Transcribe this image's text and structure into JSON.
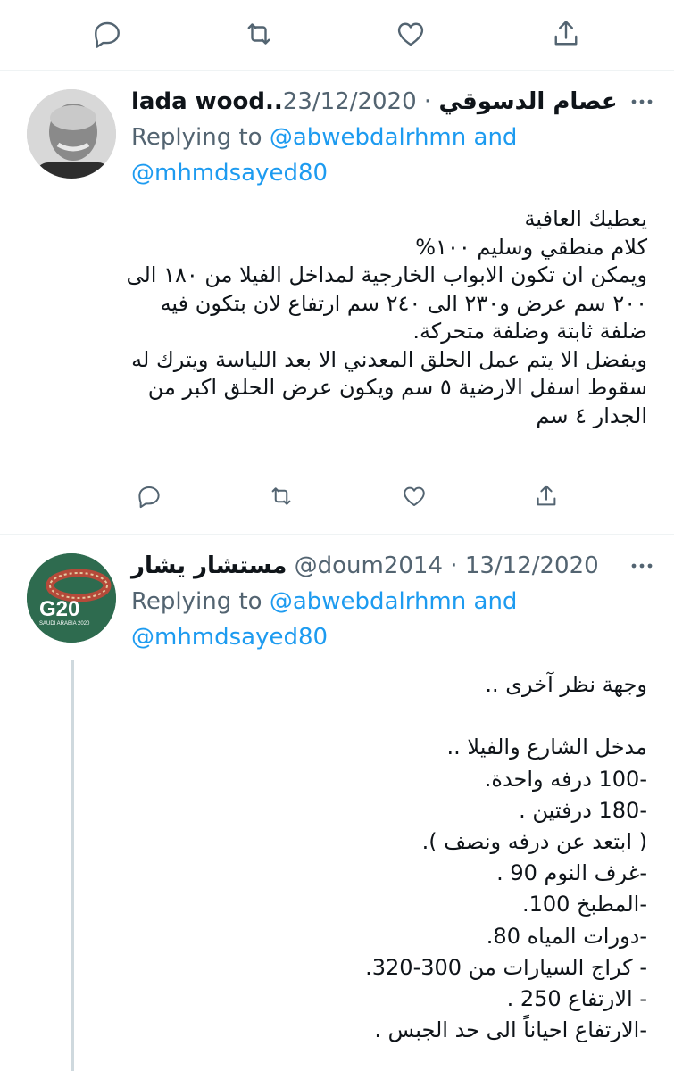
{
  "top_actions": [
    "reply-icon",
    "retweet-icon",
    "like-icon",
    "share-icon"
  ],
  "tweet1": {
    "name": "lada wood..عصام الدسوقي",
    "separator": " · ",
    "date": "23/12/2020",
    "replying_prefix": "Replying to ",
    "replying_user1": "@abwebdalrhmn",
    "replying_and": " and",
    "replying_user2": "@mhmdsayed80",
    "text": "يعطيك العافية\nكلام منطقي وسليم ١٠٠%\nويمكن ان تكون الابواب الخارجية لمداخل الفيلا من ١٨٠ الى ٢٠٠ سم عرض و٢٣٠ الى ٢٤٠ سم ارتفاع لان بتكون فيه ضلفة ثابتة وضلفة متحركة.\nويفضل الا يتم عمل الحلق المعدني الا بعد اللياسة ويترك له سقوط اسفل الارضية ٥ سم ويكون عرض الحلق اكبر من الجدار ٤ سم"
  },
  "tweet2": {
    "name": "مستشار يشار",
    "handle": "@doum2014",
    "separator": " · ",
    "date": "13/12/2020",
    "replying_prefix": "Replying to ",
    "replying_user1": "@abwebdalrhmn",
    "replying_and": " and",
    "replying_user2": "@mhmdsayed80",
    "avatar_text": "G20",
    "avatar_subtext": "SAUDI ARABIA 2020",
    "text": "وجهة نظر آخرى ..\n\nمدخل الشارع والفيلا ..\n-100 درفه واحدة.\n-180 درفتين .\n( ابتعد عن درفه ونصف ).\n-غرف النوم 90 .\n-المطبخ 100.\n-دورات المياه 80.\n- كراج السيارات من 300-320.\n- الارتفاع 250 .\n-الارتفاع احياناً الى حد الجبس ."
  },
  "colors": {
    "accent": "#1d9bf0",
    "secondary": "#536471",
    "avatar_bg": "#2e6b4f"
  }
}
